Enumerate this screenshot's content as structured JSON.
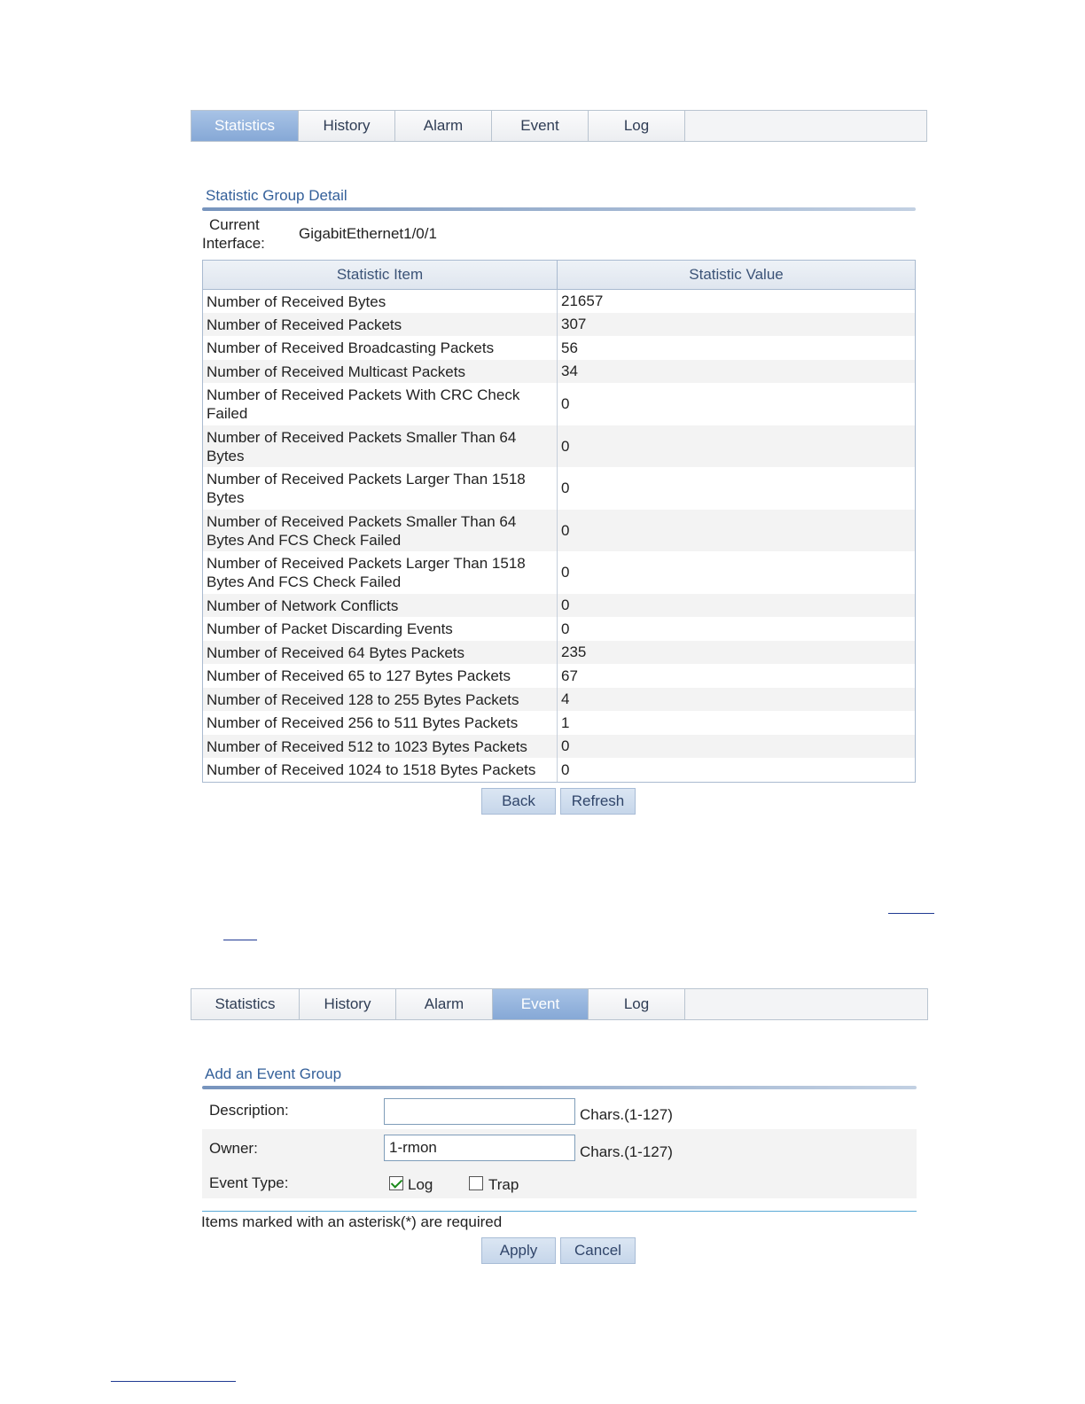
{
  "tabs_top": {
    "items": [
      "Statistics",
      "History",
      "Alarm",
      "Event",
      "Log"
    ],
    "active": "Statistics"
  },
  "detail": {
    "title": "Statistic Group Detail",
    "interface_label_1": "Current",
    "interface_label_2": "Interface:",
    "interface_value": "GigabitEthernet1/0/1",
    "col_item": "Statistic Item",
    "col_value": "Statistic Value",
    "rows": [
      {
        "item": "Number of Received Bytes",
        "value": "21657"
      },
      {
        "item": "Number of Received Packets",
        "value": "307"
      },
      {
        "item": "Number of Received Broadcasting Packets",
        "value": "56"
      },
      {
        "item": "Number of Received Multicast Packets",
        "value": "34"
      },
      {
        "item": "Number of Received Packets With CRC Check Failed",
        "value": "0"
      },
      {
        "item": "Number of Received Packets Smaller Than 64 Bytes",
        "value": "0"
      },
      {
        "item": "Number of Received Packets Larger Than 1518 Bytes",
        "value": "0"
      },
      {
        "item": "Number of Received Packets Smaller Than 64 Bytes And FCS Check Failed",
        "value": "0"
      },
      {
        "item": "Number of Received Packets Larger Than 1518 Bytes And FCS Check Failed",
        "value": "0"
      },
      {
        "item": "Number of Network Conflicts",
        "value": "0"
      },
      {
        "item": "Number of Packet Discarding Events",
        "value": "0"
      },
      {
        "item": "Number of Received 64 Bytes Packets",
        "value": "235"
      },
      {
        "item": "Number of Received 65 to 127 Bytes Packets",
        "value": "67"
      },
      {
        "item": "Number of Received 128 to 255 Bytes Packets",
        "value": "4"
      },
      {
        "item": "Number of Received 256 to 511 Bytes Packets",
        "value": "1"
      },
      {
        "item": "Number of Received 512 to 1023 Bytes Packets",
        "value": "0"
      },
      {
        "item": "Number of Received 1024 to 1518 Bytes Packets",
        "value": "0"
      }
    ],
    "back_label": "Back",
    "refresh_label": "Refresh"
  },
  "tabs_bottom": {
    "items": [
      "Statistics",
      "History",
      "Alarm",
      "Event",
      "Log"
    ],
    "active": "Event"
  },
  "event_form": {
    "title": "Add an Event Group",
    "description_label": "Description:",
    "description_value": "",
    "description_hint": "Chars.(1-127)",
    "owner_label": "Owner:",
    "owner_value": "1-rmon",
    "owner_hint": "Chars.(1-127)",
    "event_type_label": "Event Type:",
    "log_label": "Log",
    "log_checked": true,
    "trap_label": "Trap",
    "trap_checked": false,
    "required_note": "Items marked with an asterisk(*) are required",
    "apply_label": "Apply",
    "cancel_label": "Cancel"
  }
}
